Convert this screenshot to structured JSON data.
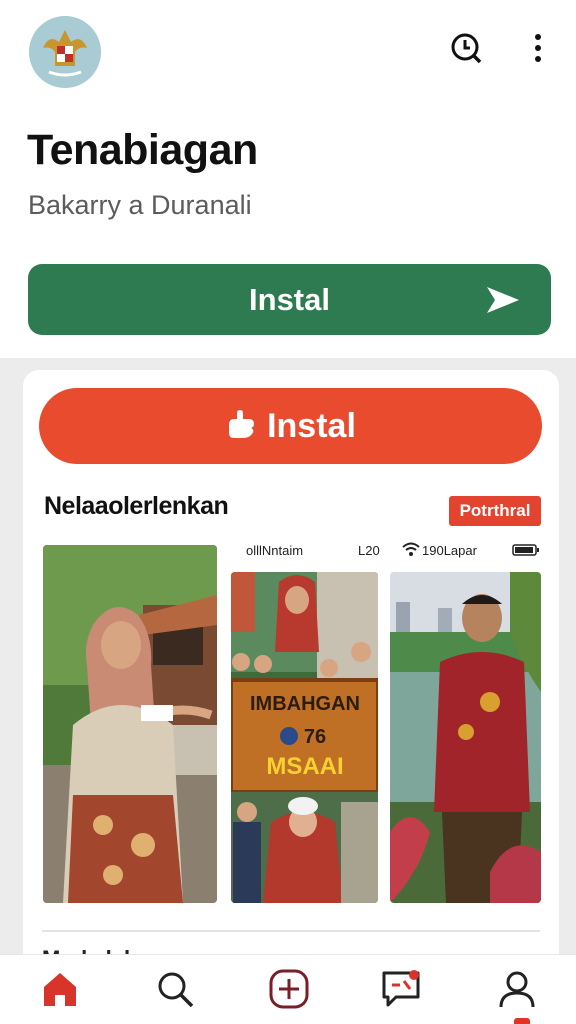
{
  "header": {
    "logo_icon": "garuda-emblem-icon",
    "actions": [
      {
        "icon": "search-chat-icon"
      },
      {
        "icon": "more-vertical-icon"
      }
    ]
  },
  "app": {
    "title": "Tenabiagan",
    "subtitle": "Bakarry a  Duranali",
    "install_label": "Instal",
    "install_color": "#2e7b51",
    "install_icon": "send-icon"
  },
  "card": {
    "install_label": "Instal",
    "install_color": "#e94b2f",
    "install_icon": "hand-icon",
    "section_title": "Nelaaolerlenkan",
    "badge": "Potrthral",
    "badge_color": "#e34430"
  },
  "statusbar": {
    "carrier": "olllNntaim",
    "value": "L20",
    "battery_label": "190Lapar",
    "icons": [
      "wifi-icon",
      "battery-icon"
    ]
  },
  "screenshots": [
    {
      "name": "woman-in-hijab-photo"
    },
    {
      "name": "sign-photo",
      "sign_line1": "IMBAHGAN",
      "sign_line2": "76",
      "sign_line3": "MSAAI"
    },
    {
      "name": "man-by-lake-photo"
    }
  ],
  "next_section_text": "Markalahan",
  "nav": {
    "items": [
      {
        "icon": "home-icon",
        "active": true
      },
      {
        "icon": "search-icon"
      },
      {
        "icon": "add-icon"
      },
      {
        "icon": "messages-icon"
      },
      {
        "icon": "profile-icon"
      }
    ],
    "active_color": "#d8342a"
  }
}
